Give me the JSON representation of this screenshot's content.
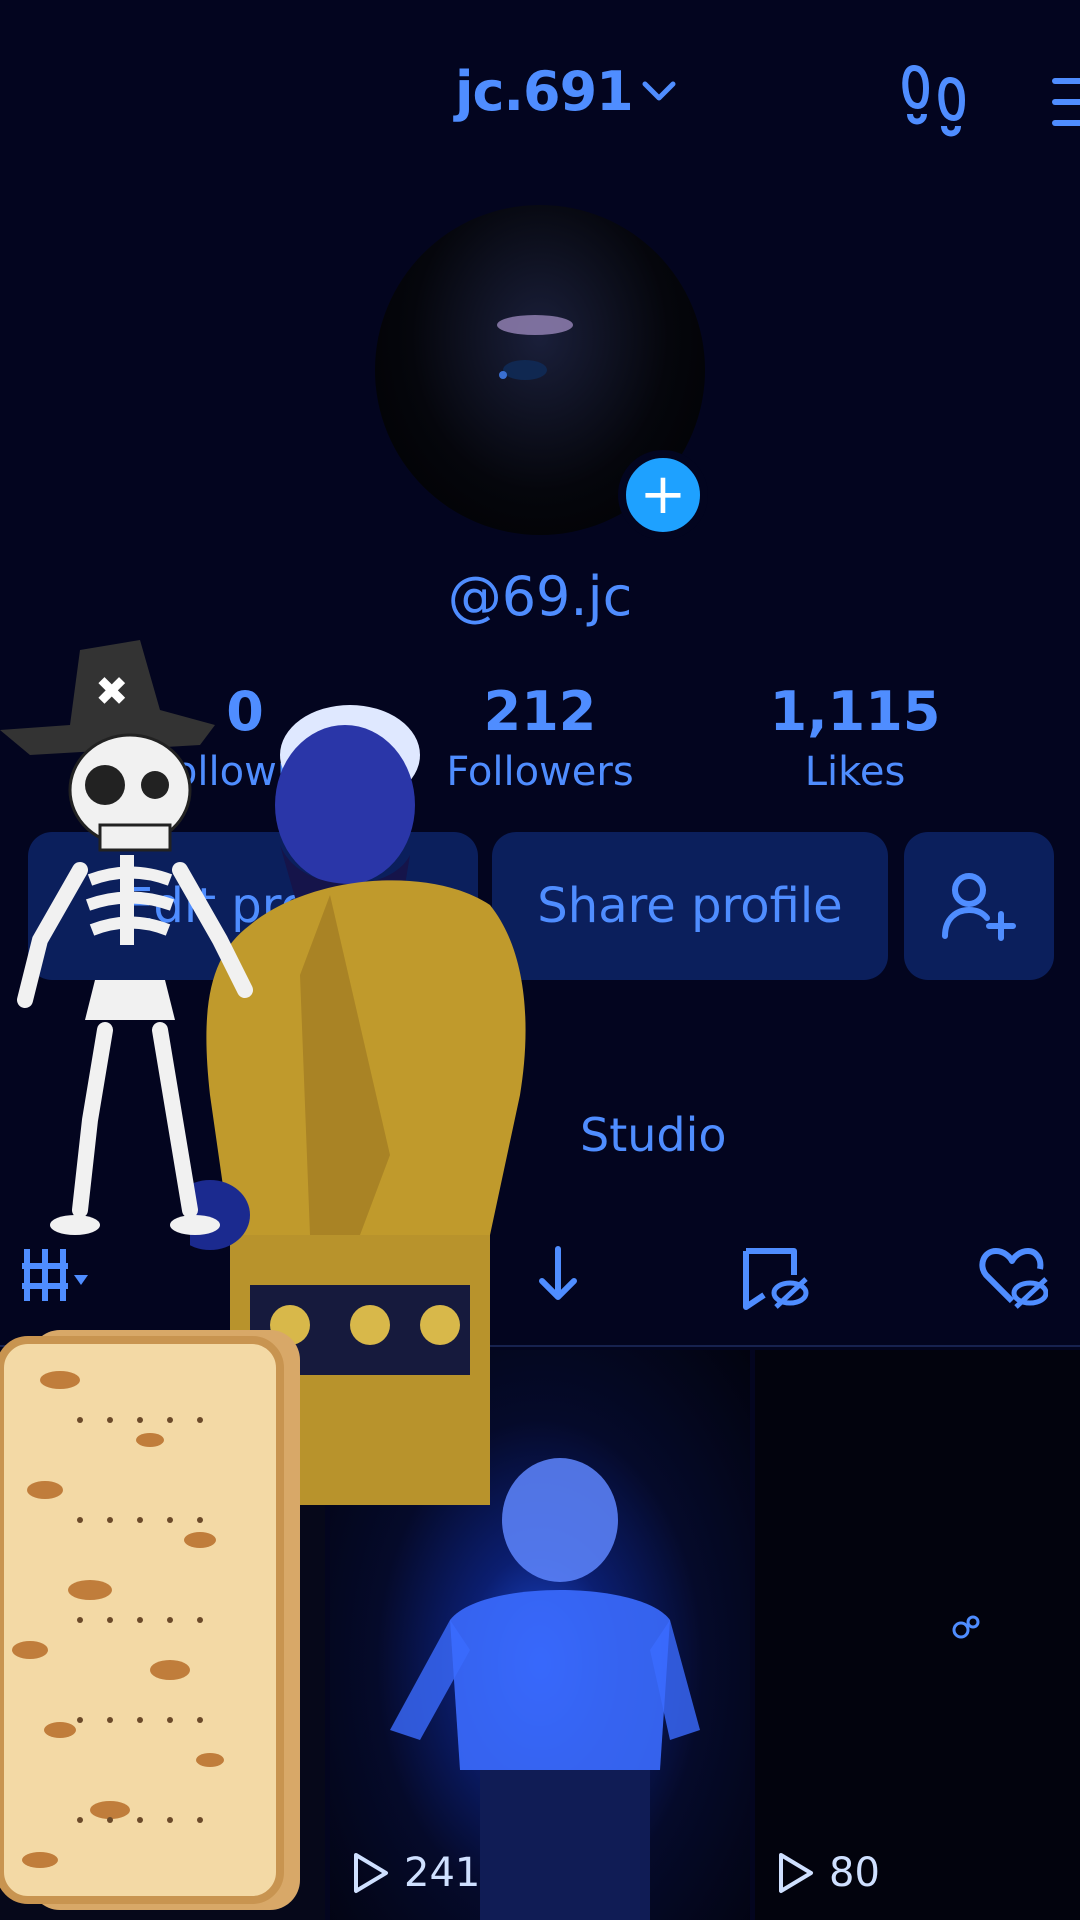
{
  "header": {
    "username": "jc.691"
  },
  "profile": {
    "handle": "@69.jc"
  },
  "stats": {
    "following": {
      "value": "0",
      "label": "Following"
    },
    "followers": {
      "value": "212",
      "label": "Followers"
    },
    "likes": {
      "value": "1,115",
      "label": "Likes"
    }
  },
  "actions": {
    "edit_label": "Edit profile",
    "share_label": "Share profile"
  },
  "studio": {
    "label": "Studio"
  },
  "videos": [
    {
      "views": ""
    },
    {
      "views": "241"
    },
    {
      "views": "80"
    }
  ],
  "colors": {
    "background": "#03051f",
    "accent": "#4f8dff",
    "badge": "#1ea1ff",
    "button": "#0b1f5c"
  }
}
